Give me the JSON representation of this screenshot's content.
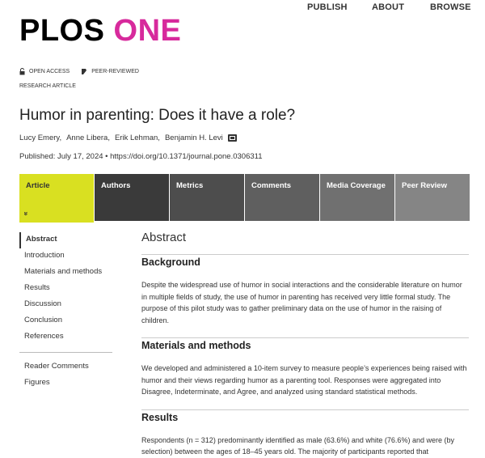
{
  "nav": {
    "publish": "PUBLISH",
    "about": "ABOUT",
    "browse": "BROWSE"
  },
  "logo": {
    "plos": "PLOS",
    "one": "ONE"
  },
  "badges": {
    "open_access": "OPEN ACCESS",
    "peer_reviewed": "PEER-REVIEWED"
  },
  "article_type": "RESEARCH ARTICLE",
  "title": "Humor in parenting: Does it have a role?",
  "authors": [
    "Lucy Emery,",
    "Anne Libera,",
    "Erik Lehman,",
    "Benjamin H. Levi"
  ],
  "pubinfo": "Published: July 17, 2024 • https://doi.org/10.1371/journal.pone.0306311",
  "tabs": [
    "Article",
    "Authors",
    "Metrics",
    "Comments",
    "Media Coverage",
    "Peer Review"
  ],
  "tab_chevron": "»",
  "toc": {
    "items": [
      "Abstract",
      "Introduction",
      "Materials and methods",
      "Results",
      "Discussion",
      "Conclusion",
      "References"
    ],
    "extra": [
      "Reader Comments",
      "Figures"
    ]
  },
  "main": {
    "abstract_title": "Abstract",
    "sections": [
      {
        "heading": "Background",
        "text": "Despite the widespread use of humor in social interactions and the considerable literature on humor in multiple fields of study, the use of humor in parenting has received very little formal study. The purpose of this pilot study was to gather preliminary data on the use of humor in the raising of children."
      },
      {
        "heading": "Materials and methods",
        "text": "We developed and administered a 10-item survey to measure people’s experiences being raised with humor and their views regarding humor as a parenting tool. Responses were aggregated into Disagree, Indeterminate, and Agree, and analyzed using standard statistical methods."
      },
      {
        "heading": "Results",
        "text": "Respondents (n = 312) predominantly identified as male (63.6%) and white (76.6%) and were (by selection) between the ages of 18–45 years old. The majority of participants reported that"
      }
    ]
  },
  "colors": {
    "brand_pink": "#d72a9c",
    "active_tab": "#d9e021"
  }
}
